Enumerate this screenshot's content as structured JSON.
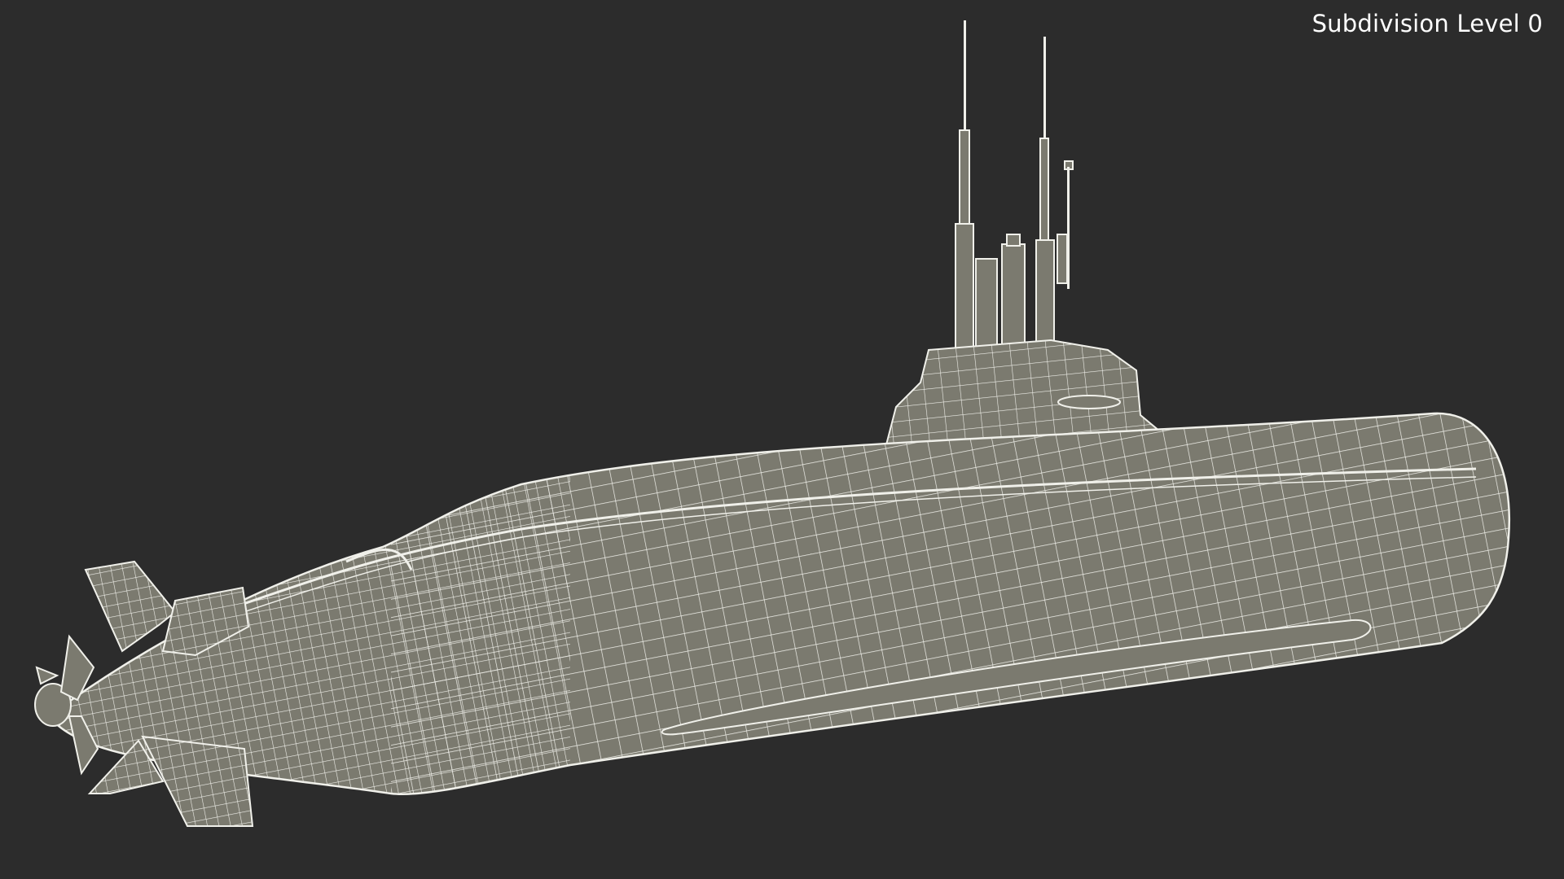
{
  "viewport": {
    "overlay_label": "Subdivision Level 0",
    "background_color": "#2c2c2c",
    "model_fill_color": "#7b7a6f",
    "wire_color": "#f2f2ec"
  },
  "model": {
    "subject": "submarine",
    "display_mode": "wireframe-on-shaded"
  }
}
